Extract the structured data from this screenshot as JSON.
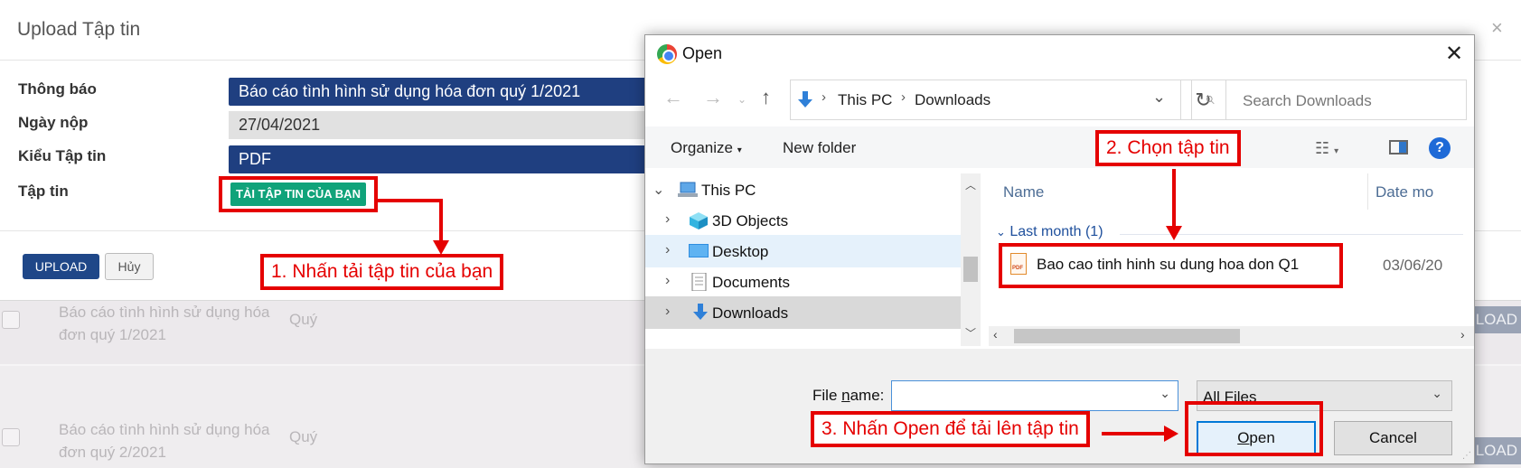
{
  "background": {
    "rows": [
      {
        "title_line1": "Báo cáo tình hình sử dụng hóa",
        "title_line2": "đơn quý 1/2021",
        "period": "Quý",
        "action": "LOAD"
      },
      {
        "title_line1": "Báo cáo tình hình sử dụng hóa",
        "title_line2": "đơn quý 2/2021",
        "period": "Quý",
        "action": "LOAD"
      }
    ]
  },
  "upload_modal": {
    "title": "Upload Tập tin",
    "close": "×",
    "fields": [
      {
        "label": "Thông báo",
        "value": "Báo cáo tình hình sử dụng hóa đơn quý 1/2021"
      },
      {
        "label": "Ngày nộp",
        "value": "27/04/2021"
      },
      {
        "label": "Kiểu Tập tin",
        "value": "PDF"
      },
      {
        "label": "Tập tin"
      }
    ],
    "select_file_button": "TẢI TẬP TIN CỦA BẠN",
    "upload_button": "UPLOAD",
    "cancel_button": "Hủy"
  },
  "open_dialog": {
    "title": "Open",
    "close": "✕",
    "address": {
      "crumbs": [
        "This PC",
        "Downloads"
      ]
    },
    "search_placeholder": "Search Downloads",
    "toolbar": {
      "organize": "Organize",
      "new_folder": "New folder",
      "help": "?"
    },
    "tree": [
      {
        "label": "This PC",
        "icon": "computer-icon",
        "expanded": true
      },
      {
        "label": "3D Objects",
        "icon": "cube-icon"
      },
      {
        "label": "Desktop",
        "icon": "desktop-icon"
      },
      {
        "label": "Documents",
        "icon": "document-icon"
      },
      {
        "label": "Downloads",
        "icon": "download-icon"
      }
    ],
    "columns": {
      "name": "Name",
      "date": "Date mo"
    },
    "group": "Last month (1)",
    "file": {
      "name": "Bao cao tinh hinh su dung hoa don Q1",
      "date": "03/06/20",
      "icon": "pdf-file-icon",
      "icon_text": "PDF"
    },
    "file_name_label_pre": "File ",
    "file_name_label_u": "n",
    "file_name_label_post": "ame:",
    "file_name_value": "",
    "file_type": "All Files",
    "open_button_u": "O",
    "open_button_rest": "pen",
    "cancel_button": "Cancel"
  },
  "annotations": {
    "step1": "1. Nhấn tải tập tin của bạn",
    "step2": "2. Chọn tập tin",
    "step3": "3. Nhấn Open để tải lên tập tin",
    "color": "#e50000"
  }
}
